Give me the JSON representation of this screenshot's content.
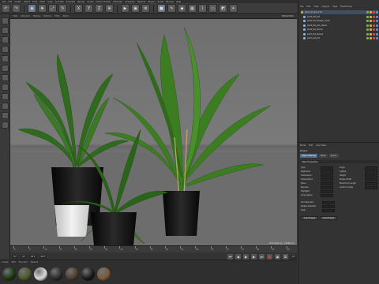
{
  "menubar": [
    "File",
    "Edit",
    "Create",
    "Select",
    "Tools",
    "Mesh",
    "Snap",
    "Animate",
    "Simulate",
    "Render",
    "Sculpt",
    "Motion Tracker",
    "MoGraph",
    "Character",
    "Pipeline",
    "Plugins",
    "Script",
    "Window",
    "Help"
  ],
  "viewport": {
    "menu": [
      "View",
      "Cameras",
      "Display",
      "Options",
      "Filter",
      "Panel"
    ],
    "name": "Perspective",
    "status": "Grid Spacing : 10000 cm"
  },
  "timeline": {
    "ticks": [
      "0",
      "5",
      "10",
      "15",
      "20",
      "25",
      "30",
      "35",
      "40",
      "45",
      "50",
      "55",
      "60",
      "65",
      "70",
      "75",
      "80",
      "85",
      "90"
    ],
    "current_frame": "0 F",
    "start_frame": "0 F",
    "end_frame": "90 F",
    "max_frame": "90 F",
    "right_frame": "0 F"
  },
  "materials": {
    "menu": [
      "Create",
      "Edit",
      "Function",
      "Texture"
    ],
    "swatches": [
      "#1c3a14",
      "#4a5a2a",
      "#d8d8d8",
      "#2b2b2b",
      "#4d3b2a",
      "#1a1a1a",
      "#7a5a38"
    ]
  },
  "object_manager": {
    "menu": [
      "File",
      "Edit",
      "View",
      "Objects",
      "Tags",
      "Bookmarks"
    ],
    "rows": [
      "palm_04_set_c4d",
      "plant_06_pot",
      "plant_06_foliage_mesh",
      "plant_06_pot_stems",
      "plant_06_stems",
      "palm_04_leaves",
      "palm_04_pot"
    ]
  },
  "attributes": {
    "menu": [
      "Mode",
      "Edit",
      "User Data"
    ],
    "title": "Object",
    "tabs": [
      "Object Settings",
      "Basic",
      "Coord."
    ],
    "section": "Object Properties",
    "left_props": [
      "Type",
      "Segments",
      "Subdivision",
      "Interpolation",
      "Plane",
      "Reverse",
      "Highlight",
      "Close Spline"
    ],
    "right_props": [
      "Angle",
      "Lateral",
      "Height",
      "Shape Width",
      "Maximum Length",
      "Uniform Angle"
    ],
    "bottom_props": [
      "Add Selected",
      "Delete Selected",
      "Clear"
    ],
    "buttons": [
      "Load Preset",
      "Save Preset"
    ]
  }
}
